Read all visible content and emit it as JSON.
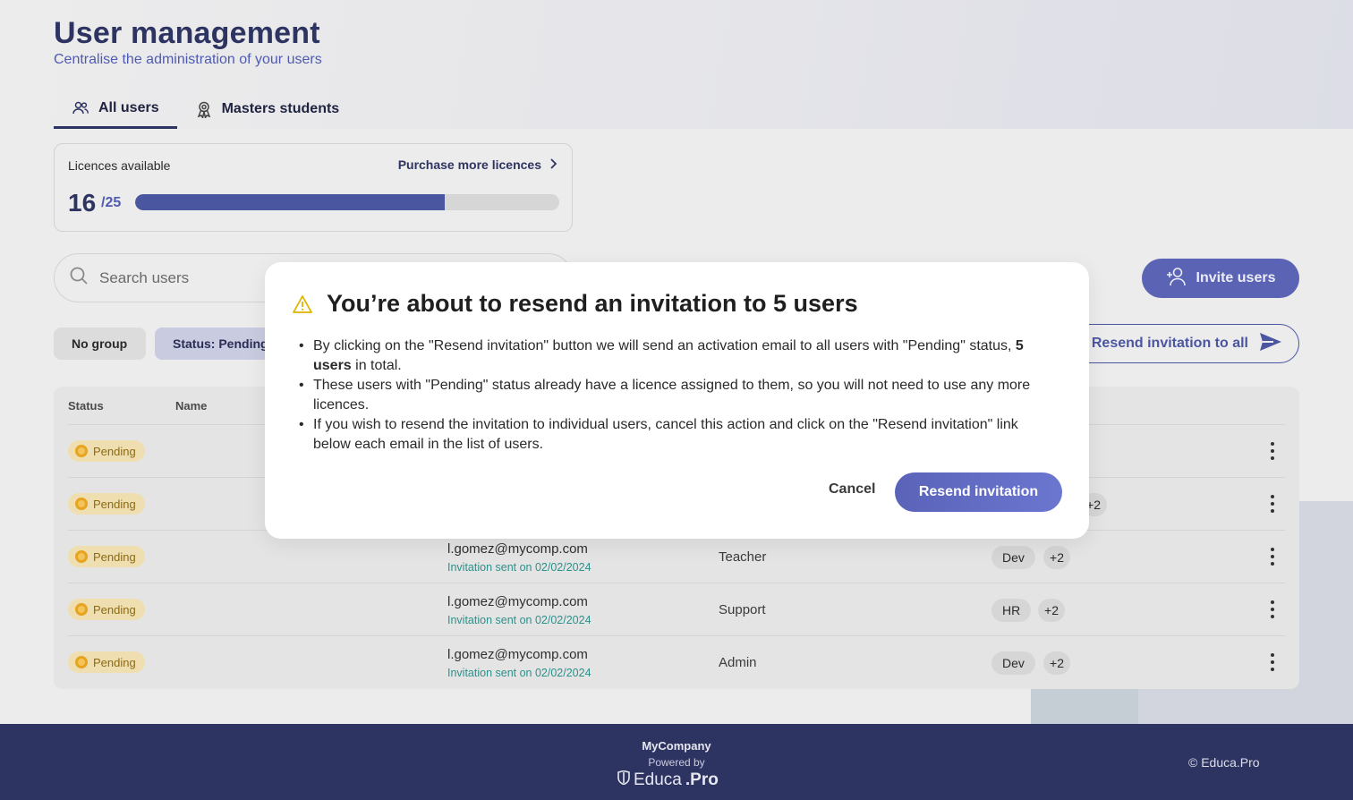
{
  "header": {
    "title": "User management",
    "subtitle": "Centralise the administration of your users"
  },
  "tabs": [
    {
      "label": "All users",
      "icon": "users-icon",
      "active": true
    },
    {
      "label": "Masters students",
      "icon": "award-icon",
      "active": false
    }
  ],
  "licences": {
    "label": "Licences available",
    "purchase_link": "Purchase more licences",
    "used": "16",
    "total": "/25",
    "fill_fraction": 0.73
  },
  "search": {
    "placeholder": "Search users"
  },
  "toolbar": {
    "invite_label": "Invite users",
    "resend_all_label": "Resend invitation to all",
    "filter_no_group": "No group",
    "filter_status": "Status: Pending"
  },
  "table": {
    "columns": [
      "Status",
      "Name"
    ],
    "rows": [
      {
        "status": "Pending",
        "email": "",
        "sent": "",
        "role": "",
        "group": "",
        "more": ""
      },
      {
        "status": "Pending",
        "email": "",
        "sent": "",
        "role": "",
        "group": "",
        "more": "+2"
      },
      {
        "status": "Pending",
        "email": "l.gomez@mycomp.com",
        "sent": "Invitation sent on 02/02/2024",
        "role": "Teacher",
        "group": "Dev",
        "more": "+2"
      },
      {
        "status": "Pending",
        "email": "l.gomez@mycomp.com",
        "sent": "Invitation sent on 02/02/2024",
        "role": "Support",
        "group": "HR",
        "more": "+2"
      },
      {
        "status": "Pending",
        "email": "l.gomez@mycomp.com",
        "sent": "Invitation sent on 02/02/2024",
        "role": "Admin",
        "group": "Dev",
        "more": "+2"
      }
    ]
  },
  "modal": {
    "title": "You’re about to resend an invitation to 5 users",
    "bullet1_a": "By clicking on the \"Resend invitation\" button we will send an activation email to all users with \"Pending\" status, ",
    "bullet1_bold": "5 users",
    "bullet1_b": " in total.",
    "bullet2": "These users with \"Pending\" status already have a licence assigned to them, so you will not need to use any more licences.",
    "bullet3": "If you wish to resend the invitation to individual users, cancel this action and click on the \"Resend invitation\" link below each email in the list of users.",
    "cancel_label": "Cancel",
    "confirm_label": "Resend invitation"
  },
  "footer": {
    "company": "MyCompany",
    "powered": "Powered by",
    "logo_a": "Educa",
    "logo_b": ".Pro",
    "copyright": "© Educa.Pro"
  },
  "colors": {
    "brand_navy": "#2e3461",
    "accent": "#5a63b4",
    "pending_bg": "#efdfb0",
    "pending_text": "#8c6a14",
    "teal": "#2f8f8a"
  }
}
